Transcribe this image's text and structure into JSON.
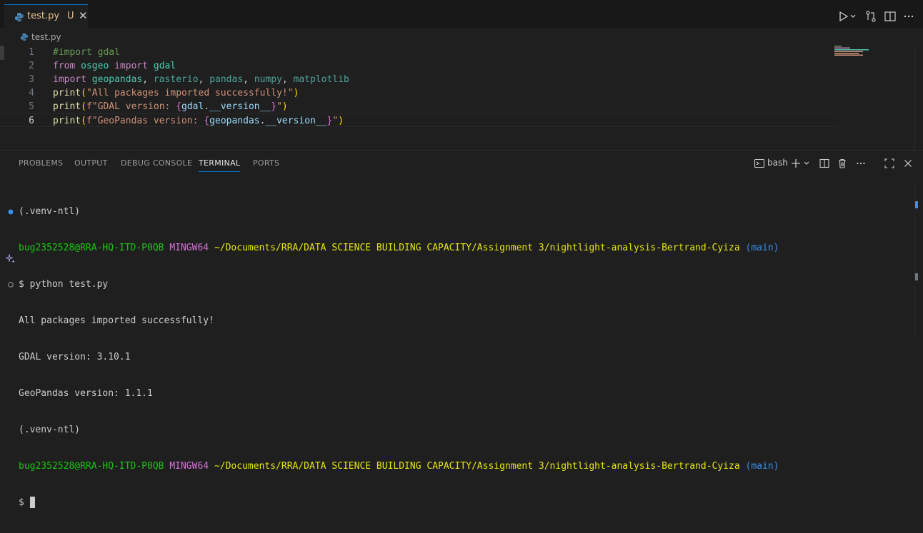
{
  "tab": {
    "filename": "test.py",
    "status": "U",
    "close": "✕"
  },
  "breadcrumb": {
    "file": "test.py"
  },
  "editor": {
    "line_numbers": [
      "1",
      "2",
      "3",
      "4",
      "5",
      "6"
    ],
    "lines": {
      "l1": {
        "comment": "#import gdal"
      },
      "l2": {
        "from": "from",
        "mod": "osgeo",
        "import": "import",
        "name": "gdal"
      },
      "l3": {
        "import": "import",
        "m1": "geopandas",
        "sep1": ", ",
        "m2": "rasterio",
        "sep2": ", ",
        "m3": "pandas",
        "sep3": ", ",
        "m4": "numpy",
        "sep4": ", ",
        "m5": "matplotlib"
      },
      "l4": {
        "fn": "print",
        "open": "(",
        "str": "\"All packages imported successfully!\"",
        "close": ")"
      },
      "l5": {
        "fn": "print",
        "open": "(",
        "pre": "f\"GDAL version: ",
        "bo": "{",
        "v1": "gdal",
        "dot": ".",
        "v2": "__version__",
        "bc": "}",
        "end": "\"",
        "close": ")"
      },
      "l6": {
        "fn": "print",
        "open": "(",
        "pre": "f\"GeoPandas version: ",
        "bo": "{",
        "v1": "geopandas",
        "dot": ".",
        "v2": "__version__",
        "bc": "}",
        "end": "\"",
        "close": ")"
      }
    }
  },
  "panel": {
    "tabs": [
      "PROBLEMS",
      "OUTPUT",
      "DEBUG CONSOLE",
      "TERMINAL",
      "PORTS"
    ],
    "active_tab": "TERMINAL",
    "shell": "bash"
  },
  "terminal": {
    "venv1": "(.venv-ntl)",
    "user": "bug2352528@RRA-HQ-ITD-P0QB",
    "shell_name": "MINGW64",
    "path": "~/Documents/RRA/DATA SCIENCE BUILDING CAPACITY/Assignment 3/nightlight-analysis-Bertrand-Cyiza",
    "branch": "(main)",
    "command": "$ python test.py",
    "out1": "All packages imported successfully!",
    "out2": "GDAL version: 3.10.1",
    "out3": "GeoPandas version: 1.1.1",
    "venv2": "(.venv-ntl)",
    "prompt": "$ "
  },
  "colors": {
    "accent": "#0078d4",
    "prompt_green": "#16c60c",
    "prompt_magenta": "#d670d6",
    "path_yellow": "#e5e510",
    "branch_blue": "#3b8eea"
  }
}
